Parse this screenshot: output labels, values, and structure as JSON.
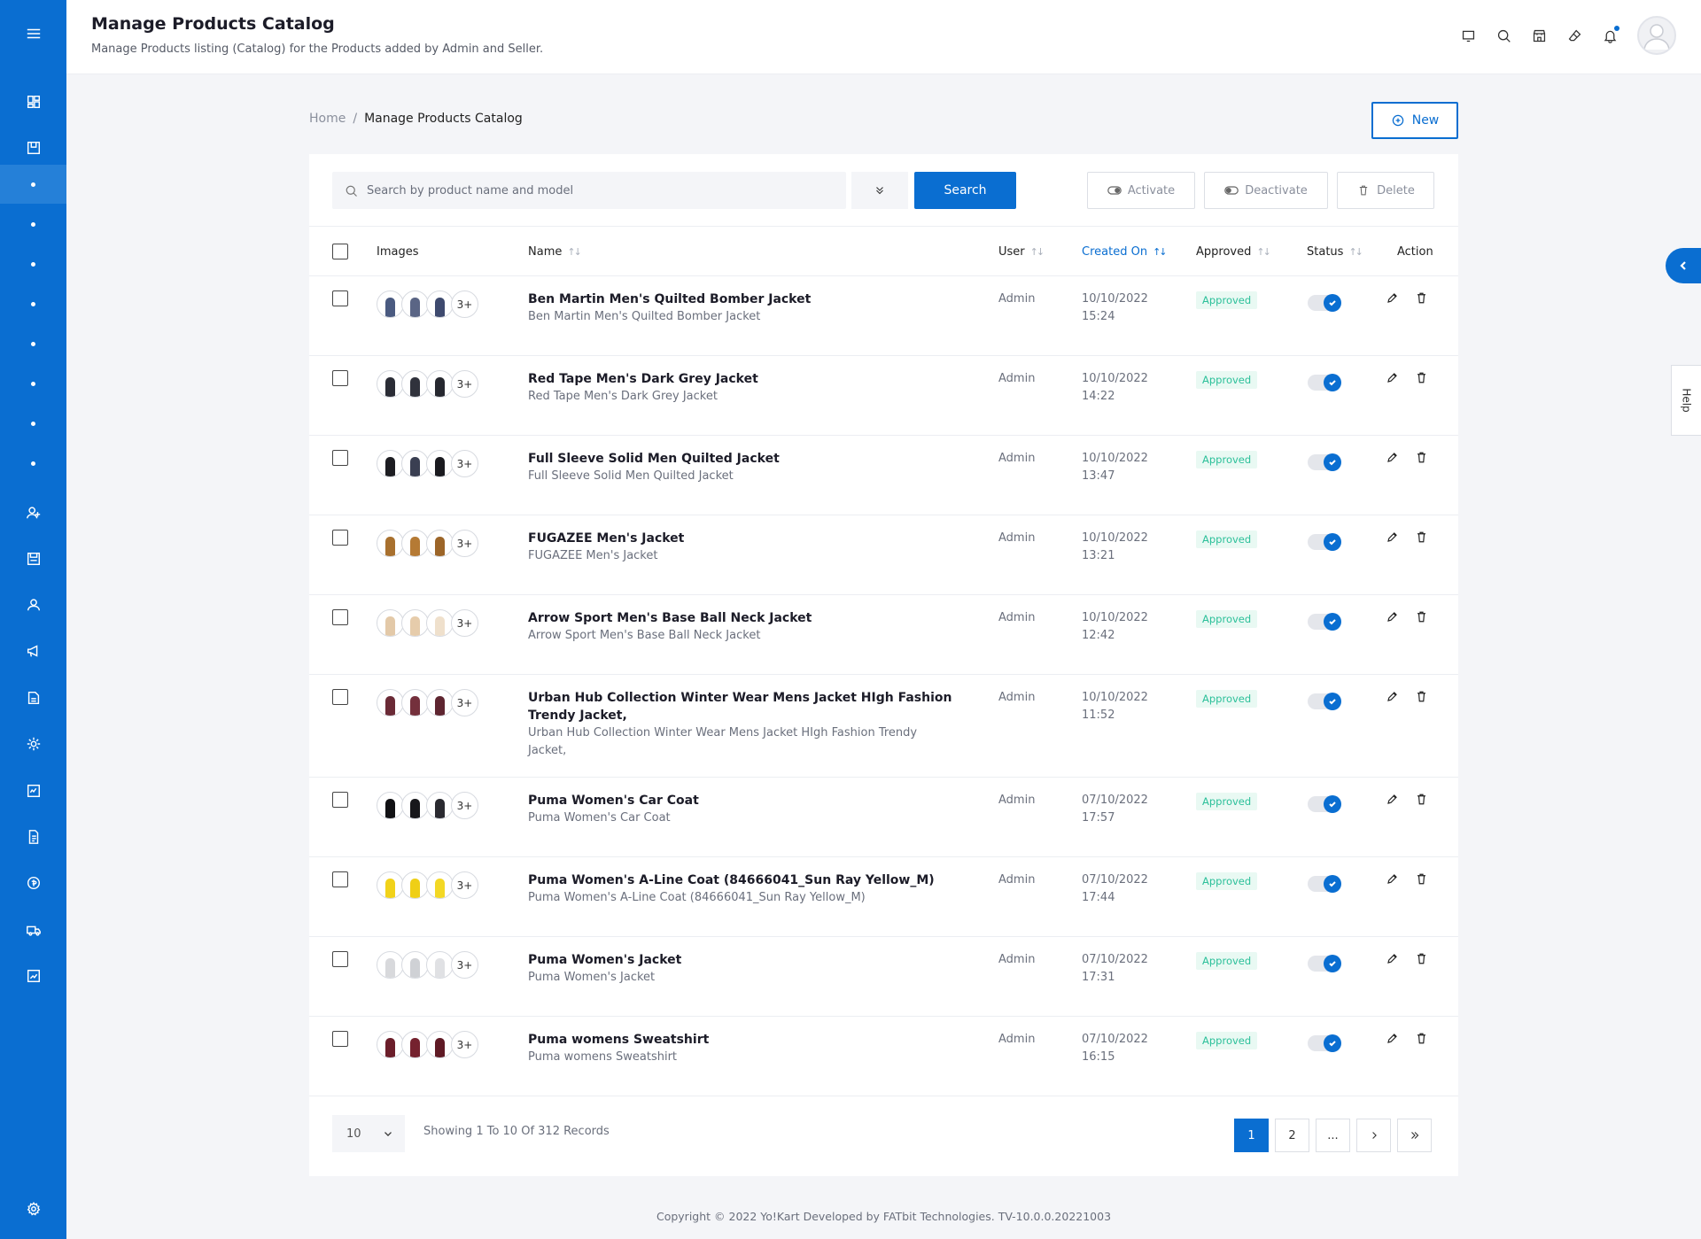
{
  "header": {
    "title": "Manage Products Catalog",
    "subtitle": "Manage Products listing (Catalog) for the Products added by Admin and Seller."
  },
  "icons": {
    "header": [
      "monitor-icon",
      "search-icon",
      "store-icon",
      "eraser-icon",
      "bell-icon"
    ],
    "sidebar": [
      "dashboard-icon",
      "catalog-icon",
      "users-icon",
      "orders-icon",
      "user-icon",
      "megaphone-icon",
      "cms-icon",
      "settings-icon",
      "reports-icon",
      "document-icon",
      "payment-icon",
      "shipping-icon",
      "sales-icon",
      "gear-icon"
    ]
  },
  "breadcrumb": {
    "home": "Home",
    "separator": "/",
    "current": "Manage Products Catalog"
  },
  "actions": {
    "new_label": "New"
  },
  "toolbar": {
    "search_placeholder": "Search by product name and model",
    "search_label": "Search",
    "activate_label": "Activate",
    "deactivate_label": "Deactivate",
    "delete_label": "Delete"
  },
  "table": {
    "columns": {
      "images": "Images",
      "name": "Name",
      "user": "User",
      "created_on": "Created On",
      "approved": "Approved",
      "status": "Status",
      "action": "Action"
    },
    "more_label": "3+",
    "rows": [
      {
        "name": "Ben Martin Men's Quilted Bomber Jacket",
        "model": "Ben Martin Men's Quilted Bomber Jacket",
        "user": "Admin",
        "date": "10/10/2022",
        "time": "15:24",
        "approved": "Approved",
        "status_active": true,
        "thumb_colors": [
          "#4a5a80",
          "#5a6585",
          "#3e4a6e"
        ]
      },
      {
        "name": "Red Tape Men's Dark Grey Jacket",
        "model": "Red Tape Men's Dark Grey Jacket",
        "user": "Admin",
        "date": "10/10/2022",
        "time": "14:22",
        "approved": "Approved",
        "status_active": true,
        "thumb_colors": [
          "#2b2d36",
          "#30323c",
          "#26282f"
        ]
      },
      {
        "name": "Full Sleeve Solid Men Quilted Jacket",
        "model": "Full Sleeve Solid Men Quilted Jacket",
        "user": "Admin",
        "date": "10/10/2022",
        "time": "13:47",
        "approved": "Approved",
        "status_active": true,
        "thumb_colors": [
          "#1d1d22",
          "#3a3f52",
          "#1a1a1f"
        ]
      },
      {
        "name": "FUGAZEE Men's Jacket",
        "model": "FUGAZEE Men's Jacket",
        "user": "Admin",
        "date": "10/10/2022",
        "time": "13:21",
        "approved": "Approved",
        "status_active": true,
        "thumb_colors": [
          "#a8702e",
          "#b57a34",
          "#9c6528"
        ]
      },
      {
        "name": "Arrow Sport Men's Base Ball Neck Jacket",
        "model": "Arrow Sport Men's Base Ball Neck Jacket",
        "user": "Admin",
        "date": "10/10/2022",
        "time": "12:42",
        "approved": "Approved",
        "status_active": true,
        "thumb_colors": [
          "#e3c9a8",
          "#e6ccab",
          "#efe0cc"
        ]
      },
      {
        "name": "Urban Hub Collection Winter Wear Mens Jacket HIgh Fashion Trendy Jacket,",
        "model": "Urban Hub Collection Winter Wear Mens Jacket HIgh Fashion Trendy Jacket,",
        "user": "Admin",
        "date": "10/10/2022",
        "time": "11:52",
        "approved": "Approved",
        "status_active": true,
        "thumb_colors": [
          "#6a2a36",
          "#74303c",
          "#5e2530"
        ]
      },
      {
        "name": "Puma Women's Car Coat",
        "model": "Puma Women's Car Coat",
        "user": "Admin",
        "date": "07/10/2022",
        "time": "17:57",
        "approved": "Approved",
        "status_active": true,
        "thumb_colors": [
          "#111114",
          "#17171b",
          "#2a2a30"
        ]
      },
      {
        "name": "Puma Women's A-Line Coat (84666041_Sun Ray Yellow_M)",
        "model": "Puma Women's A-Line Coat (84666041_Sun Ray Yellow_M)",
        "user": "Admin",
        "date": "07/10/2022",
        "time": "17:44",
        "approved": "Approved",
        "status_active": true,
        "thumb_colors": [
          "#f1d21a",
          "#efcf16",
          "#f3d825"
        ]
      },
      {
        "name": "Puma Women's Jacket",
        "model": "Puma Women's Jacket",
        "user": "Admin",
        "date": "07/10/2022",
        "time": "17:31",
        "approved": "Approved",
        "status_active": true,
        "thumb_colors": [
          "#d8d9dc",
          "#cfd1d5",
          "#e0e1e4"
        ]
      },
      {
        "name": "Puma womens Sweatshirt",
        "model": "Puma womens Sweatshirt",
        "user": "Admin",
        "date": "07/10/2022",
        "time": "16:15",
        "approved": "Approved",
        "status_active": true,
        "thumb_colors": [
          "#6b1e2a",
          "#75222f",
          "#5f1a25"
        ]
      }
    ]
  },
  "pagination": {
    "per_page": "10",
    "showing": "Showing 1 To 10 Of 312 Records",
    "pages": [
      "1",
      "2",
      "..."
    ],
    "current": "1"
  },
  "help_label": "Help",
  "footer": {
    "copyright": "Copyright © 2022 Yo!Kart Developed by FATbit Technologies. TV-10.0.0.20221003"
  },
  "colors": {
    "primary": "#0a6ed1",
    "approved_text": "#2cc09a",
    "approved_bg": "#e9f9f3"
  }
}
